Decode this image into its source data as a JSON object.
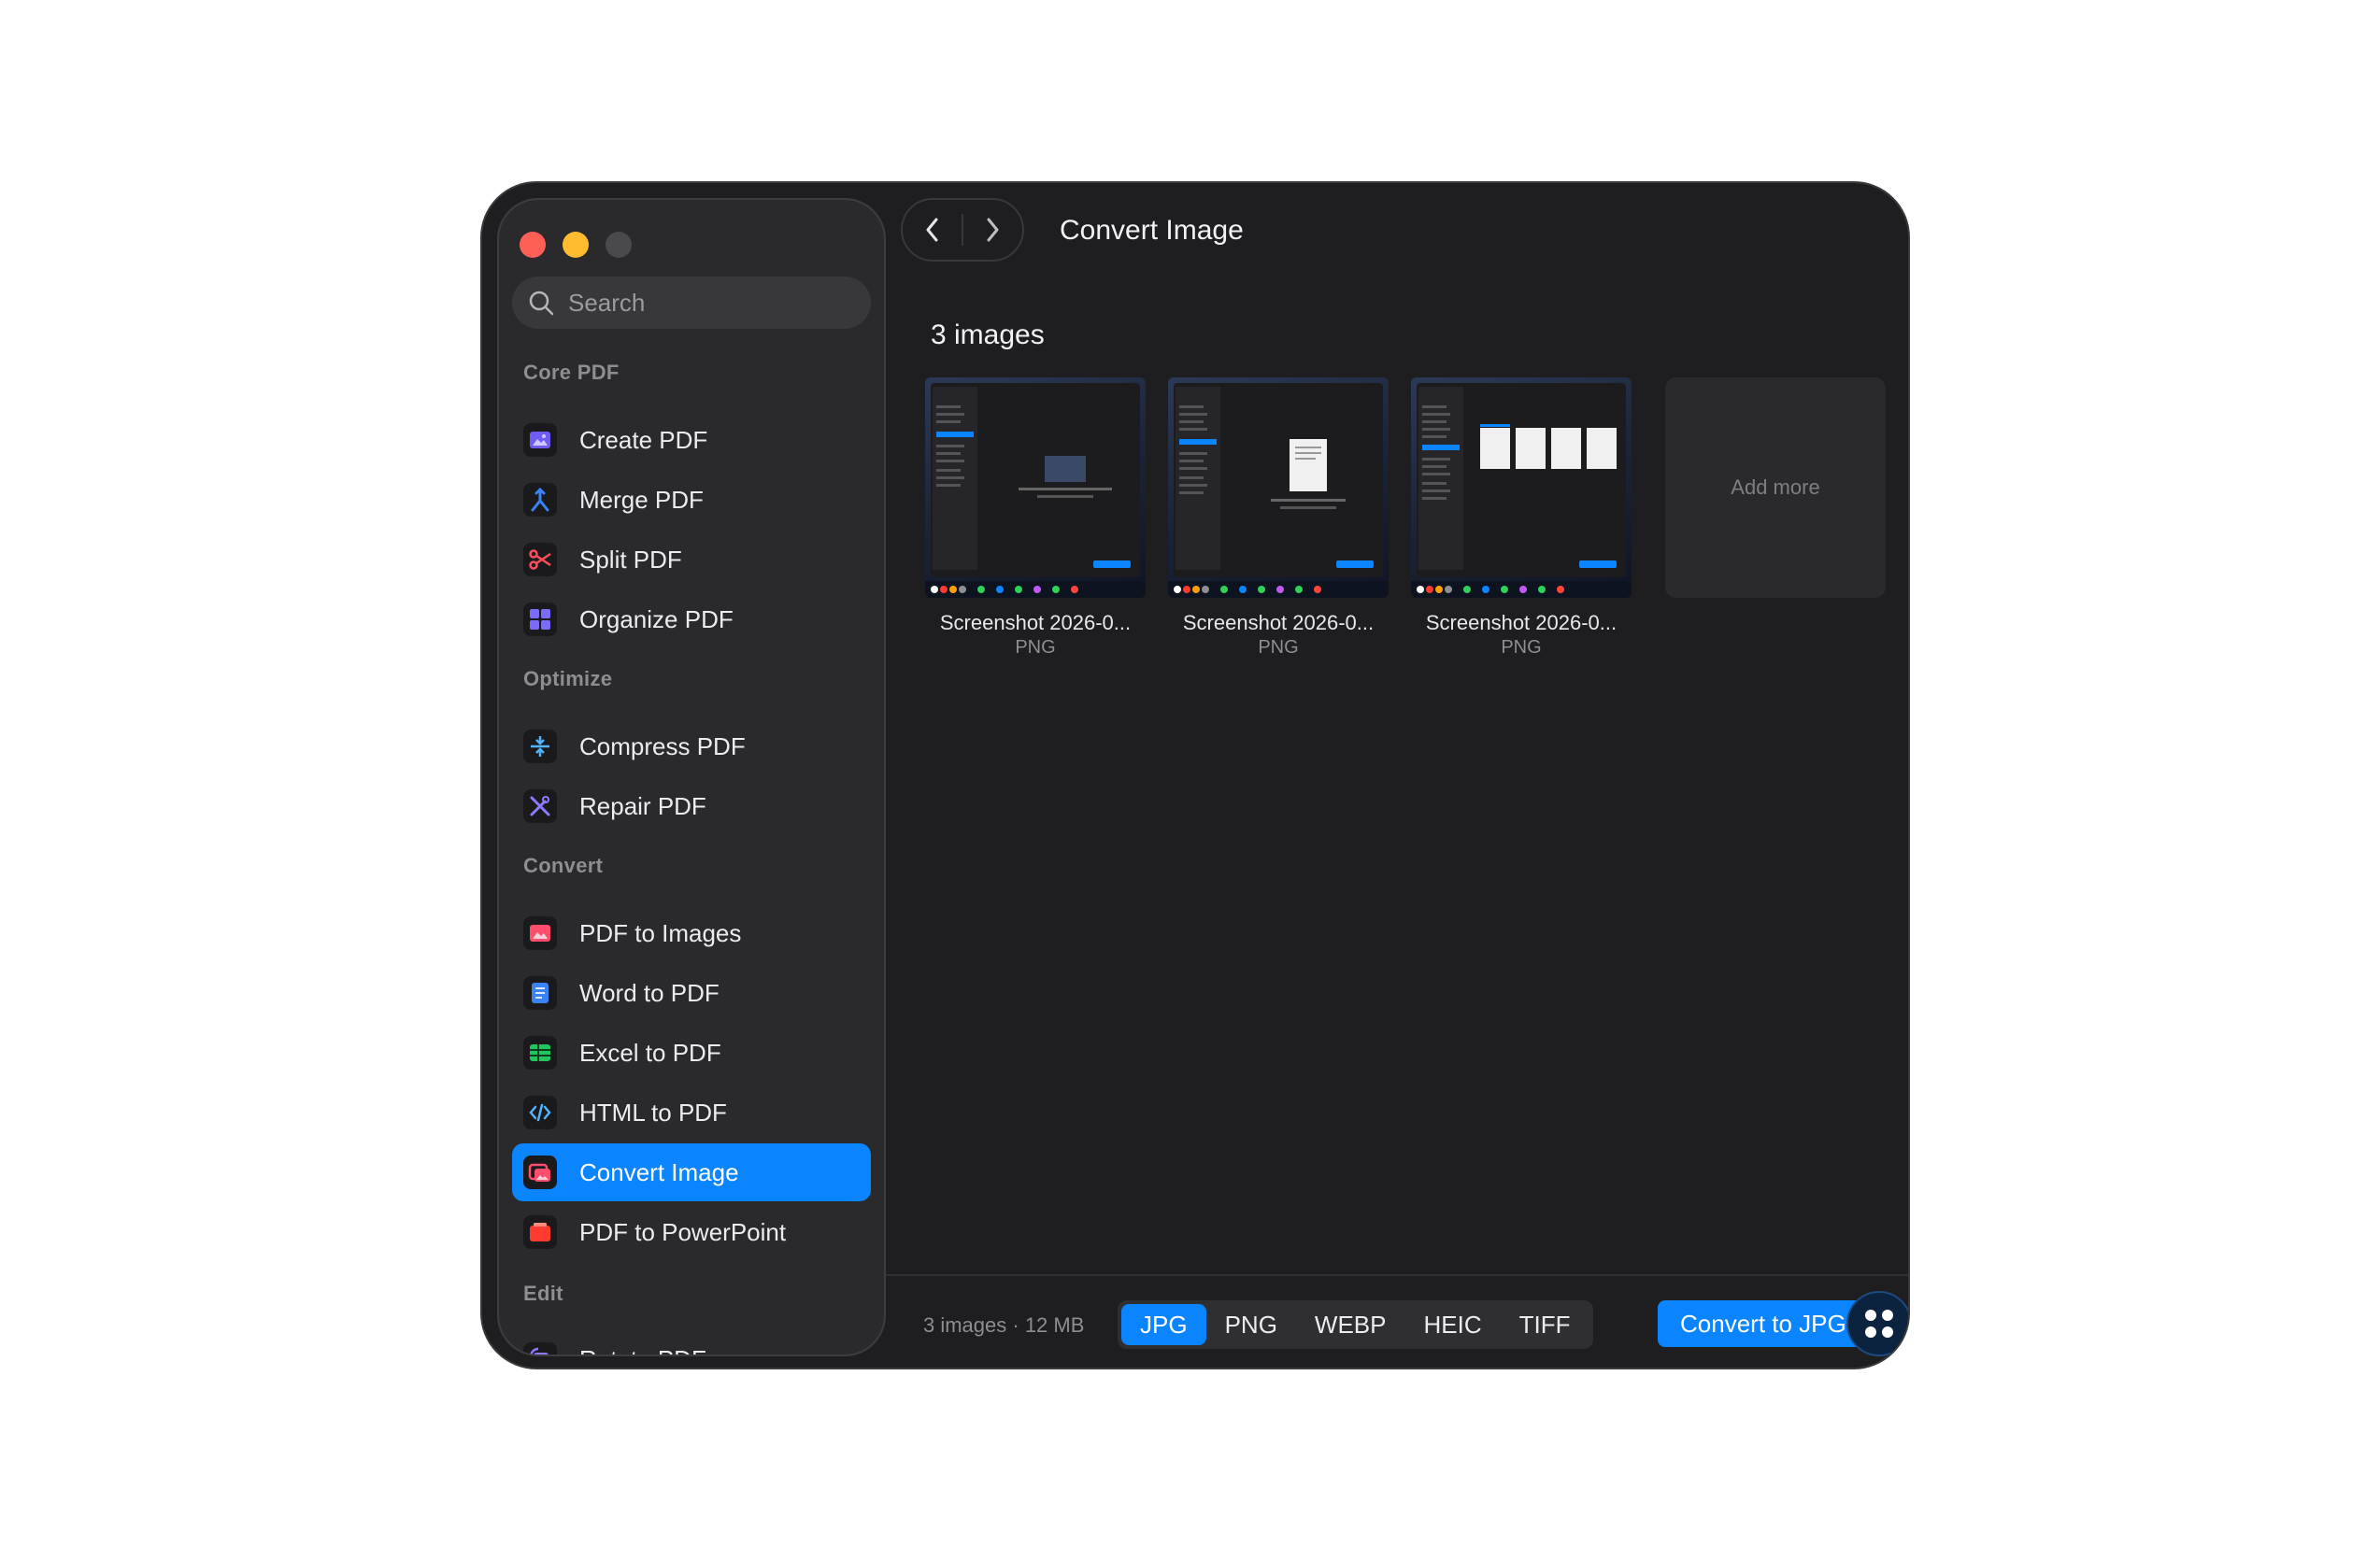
{
  "sidebar": {
    "search_placeholder": "Search",
    "sections": [
      {
        "title": "Core PDF",
        "items": [
          {
            "label": "Create PDF",
            "icon": "image-pdf-icon"
          },
          {
            "label": "Merge PDF",
            "icon": "merge-icon"
          },
          {
            "label": "Split PDF",
            "icon": "scissors-icon"
          },
          {
            "label": "Organize PDF",
            "icon": "grid-icon"
          }
        ]
      },
      {
        "title": "Optimize",
        "items": [
          {
            "label": "Compress PDF",
            "icon": "compress-icon"
          },
          {
            "label": "Repair PDF",
            "icon": "tools-icon"
          }
        ]
      },
      {
        "title": "Convert",
        "items": [
          {
            "label": "PDF to Images",
            "icon": "picture-icon"
          },
          {
            "label": "Word to PDF",
            "icon": "word-icon"
          },
          {
            "label": "Excel to PDF",
            "icon": "table-icon"
          },
          {
            "label": "HTML to PDF",
            "icon": "code-icon"
          },
          {
            "label": "Convert Image",
            "icon": "images-icon",
            "active": true
          },
          {
            "label": "PDF to PowerPoint",
            "icon": "slides-icon"
          }
        ]
      },
      {
        "title": "Edit",
        "items": [
          {
            "label": "Rotate PDF",
            "icon": "rotate-icon"
          }
        ]
      }
    ]
  },
  "header": {
    "title": "Convert Image"
  },
  "main": {
    "count_title": "3 images",
    "images": [
      {
        "name": "Screenshot 2026-0...",
        "type": "PNG"
      },
      {
        "name": "Screenshot 2026-0...",
        "type": "PNG"
      },
      {
        "name": "Screenshot 2026-0...",
        "type": "PNG"
      }
    ],
    "add_more": "Add more"
  },
  "footer": {
    "info": "3 images · 12 MB",
    "formats": [
      "JPG",
      "PNG",
      "WEBP",
      "HEIC",
      "TIFF"
    ],
    "selected_format": "JPG",
    "convert_label": "Convert to JPG"
  },
  "colors": {
    "accent": "#0a84ff",
    "window_bg": "#1e1e20",
    "sidebar_bg": "#2a2a2d"
  }
}
